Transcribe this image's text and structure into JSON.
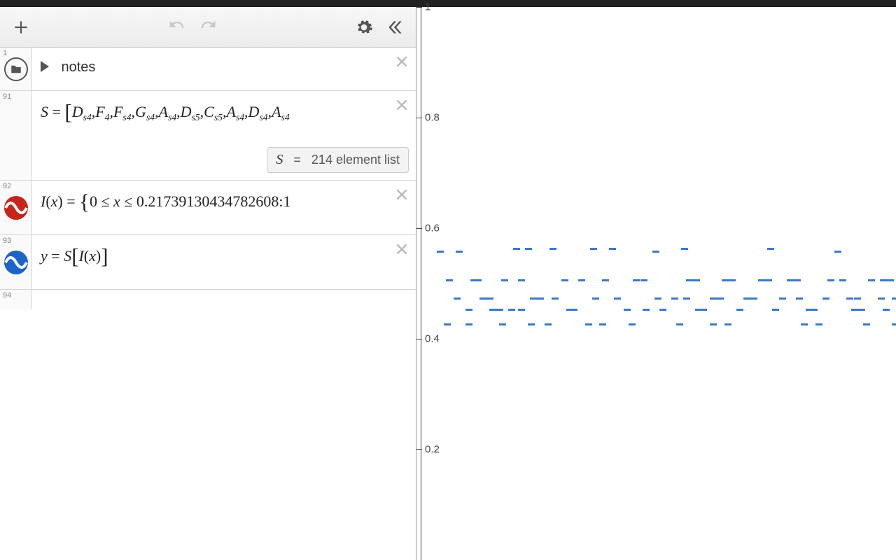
{
  "rows": {
    "r1": {
      "num": "1",
      "label": "notes"
    },
    "r91": {
      "num": "91",
      "expr_html": "<span class='ital'>S</span>&nbsp;=&nbsp;<span class='bigb'>[</span><span class='ital'>D</span><span class='sub'>s4</span>,<span class='ital'>F</span><span class='sub'>4</span>,<span class='ital'>F</span><span class='sub'>s4</span>,<span class='ital'>G</span><span class='sub'>s4</span>,<span class='ital'>A</span><span class='sub'>s4</span>,<span class='ital'>D</span><span class='sub'>s5</span>,<span class='ital'>C</span><span class='sub'>s5</span>,<span class='ital'>A</span><span class='sub'>s4</span>,<span class='ital'>D</span><span class='sub'>s4</span>,<span class='ital'>A</span><span class='sub'>s4</span>",
      "badge_var": "S",
      "badge_eq": "=",
      "badge_desc": "214 element list"
    },
    "r92": {
      "num": "92",
      "expr_html": "<span class='ital'>I</span>(<span class='ital'>x</span>)&nbsp;=&nbsp;<span class='bigb'>{</span>0&nbsp;&le;&nbsp;<span class='ital'>x</span>&nbsp;&le;&nbsp;0.21739130434782608:1"
    },
    "r93": {
      "num": "93",
      "expr_html": "<span class='ital'>y</span>&nbsp;=&nbsp;<span class='ital'>S</span><span class='bigb'>[</span><span class='ital'>I</span>(<span class='ital'>x</span>)<span class='bigb'>]</span>"
    },
    "r94": {
      "num": "94"
    }
  },
  "chart_data": {
    "type": "scatter",
    "ylim": [
      0,
      1
    ],
    "yticks": [
      0.2,
      0.4,
      0.6,
      0.8,
      1
    ],
    "ytick_labels": [
      "0.2",
      "0.4",
      "0.6",
      "0.8",
      "1"
    ],
    "points": [
      {
        "x": 0.03,
        "y": 0.56
      },
      {
        "x": 0.05,
        "y": 0.507
      },
      {
        "x": 0.065,
        "y": 0.475
      },
      {
        "x": 0.09,
        "y": 0.455
      },
      {
        "x": 0.07,
        "y": 0.56
      },
      {
        "x": 0.1,
        "y": 0.507
      },
      {
        "x": 0.11,
        "y": 0.507
      },
      {
        "x": 0.045,
        "y": 0.428
      },
      {
        "x": 0.09,
        "y": 0.428
      },
      {
        "x": 0.12,
        "y": 0.475
      },
      {
        "x": 0.135,
        "y": 0.475
      },
      {
        "x": 0.14,
        "y": 0.454
      },
      {
        "x": 0.155,
        "y": 0.454
      },
      {
        "x": 0.165,
        "y": 0.507
      },
      {
        "x": 0.19,
        "y": 0.565
      },
      {
        "x": 0.2,
        "y": 0.507
      },
      {
        "x": 0.215,
        "y": 0.565
      },
      {
        "x": 0.225,
        "y": 0.475
      },
      {
        "x": 0.24,
        "y": 0.475
      },
      {
        "x": 0.18,
        "y": 0.455
      },
      {
        "x": 0.2,
        "y": 0.455
      },
      {
        "x": 0.22,
        "y": 0.428
      },
      {
        "x": 0.255,
        "y": 0.428
      },
      {
        "x": 0.27,
        "y": 0.475
      },
      {
        "x": 0.29,
        "y": 0.507
      },
      {
        "x": 0.3,
        "y": 0.455
      },
      {
        "x": 0.31,
        "y": 0.455
      },
      {
        "x": 0.325,
        "y": 0.507
      },
      {
        "x": 0.35,
        "y": 0.565
      },
      {
        "x": 0.355,
        "y": 0.475
      },
      {
        "x": 0.375,
        "y": 0.507
      },
      {
        "x": 0.39,
        "y": 0.565
      },
      {
        "x": 0.4,
        "y": 0.475
      },
      {
        "x": 0.42,
        "y": 0.455
      },
      {
        "x": 0.44,
        "y": 0.507
      },
      {
        "x": 0.455,
        "y": 0.507
      },
      {
        "x": 0.48,
        "y": 0.56
      },
      {
        "x": 0.43,
        "y": 0.428
      },
      {
        "x": 0.46,
        "y": 0.455
      },
      {
        "x": 0.485,
        "y": 0.475
      },
      {
        "x": 0.52,
        "y": 0.475
      },
      {
        "x": 0.54,
        "y": 0.565
      },
      {
        "x": 0.55,
        "y": 0.507
      },
      {
        "x": 0.53,
        "y": 0.428
      },
      {
        "x": 0.565,
        "y": 0.507
      },
      {
        "x": 0.58,
        "y": 0.455
      },
      {
        "x": 0.6,
        "y": 0.475
      },
      {
        "x": 0.615,
        "y": 0.475
      },
      {
        "x": 0.625,
        "y": 0.507
      },
      {
        "x": 0.64,
        "y": 0.507
      },
      {
        "x": 0.655,
        "y": 0.455
      },
      {
        "x": 0.57,
        "y": 0.455
      },
      {
        "x": 0.6,
        "y": 0.428
      },
      {
        "x": 0.63,
        "y": 0.428
      },
      {
        "x": 0.67,
        "y": 0.475
      },
      {
        "x": 0.685,
        "y": 0.475
      },
      {
        "x": 0.7,
        "y": 0.507
      },
      {
        "x": 0.715,
        "y": 0.507
      },
      {
        "x": 0.72,
        "y": 0.565
      },
      {
        "x": 0.73,
        "y": 0.455
      },
      {
        "x": 0.76,
        "y": 0.507
      },
      {
        "x": 0.775,
        "y": 0.507
      },
      {
        "x": 0.78,
        "y": 0.475
      },
      {
        "x": 0.8,
        "y": 0.455
      },
      {
        "x": 0.81,
        "y": 0.455
      },
      {
        "x": 0.79,
        "y": 0.428
      },
      {
        "x": 0.82,
        "y": 0.428
      },
      {
        "x": 0.845,
        "y": 0.507
      },
      {
        "x": 0.86,
        "y": 0.56
      },
      {
        "x": 0.87,
        "y": 0.507
      },
      {
        "x": 0.885,
        "y": 0.475
      },
      {
        "x": 0.9,
        "y": 0.475
      },
      {
        "x": 0.895,
        "y": 0.455
      },
      {
        "x": 0.91,
        "y": 0.455
      },
      {
        "x": 0.93,
        "y": 0.507
      },
      {
        "x": 0.955,
        "y": 0.507
      },
      {
        "x": 0.97,
        "y": 0.507
      },
      {
        "x": 0.95,
        "y": 0.475
      },
      {
        "x": 0.98,
        "y": 0.428
      },
      {
        "x": 0.92,
        "y": 0.428
      },
      {
        "x": 0.96,
        "y": 0.455
      },
      {
        "x": 0.98,
        "y": 0.475
      },
      {
        "x": 0.265,
        "y": 0.565
      },
      {
        "x": 0.495,
        "y": 0.455
      },
      {
        "x": 0.16,
        "y": 0.428
      },
      {
        "x": 0.34,
        "y": 0.428
      },
      {
        "x": 0.37,
        "y": 0.428
      },
      {
        "x": 0.545,
        "y": 0.475
      },
      {
        "x": 0.745,
        "y": 0.475
      },
      {
        "x": 0.835,
        "y": 0.475
      }
    ]
  }
}
